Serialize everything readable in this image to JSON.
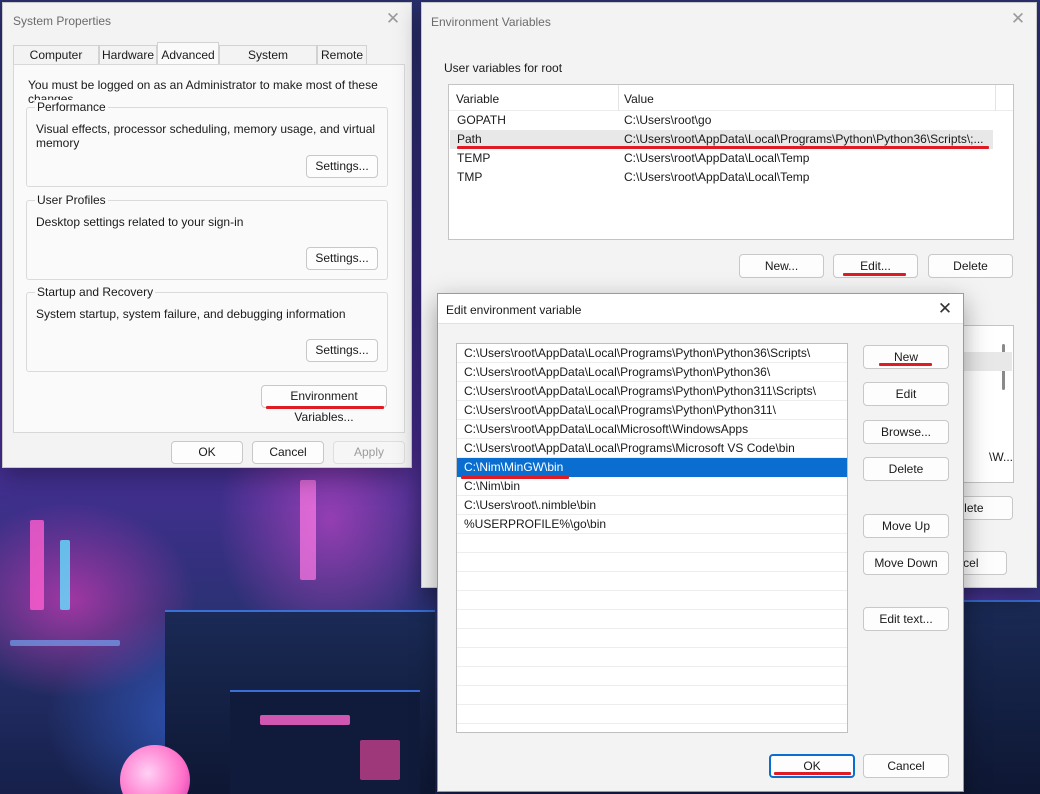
{
  "system_properties": {
    "title": "System Properties",
    "tabs": [
      "Computer Name",
      "Hardware",
      "Advanced",
      "System Protection",
      "Remote"
    ],
    "active_tab": "Advanced",
    "notice": "You must be logged on as an Administrator to make most of these changes.",
    "groups": [
      {
        "title": "Performance",
        "desc": "Visual effects, processor scheduling, memory usage, and virtual memory",
        "button": "Settings..."
      },
      {
        "title": "User Profiles",
        "desc": "Desktop settings related to your sign-in",
        "button": "Settings..."
      },
      {
        "title": "Startup and Recovery",
        "desc": "System startup, system failure, and debugging information",
        "button": "Settings..."
      }
    ],
    "env_button": "Environment Variables...",
    "ok": "OK",
    "cancel": "Cancel",
    "apply": "Apply"
  },
  "environment_variables": {
    "title": "Environment Variables",
    "user_section": "User variables for root",
    "columns": [
      "Variable",
      "Value"
    ],
    "rows": [
      {
        "variable": "GOPATH",
        "value": "C:\\Users\\root\\go"
      },
      {
        "variable": "Path",
        "value": "C:\\Users\\root\\AppData\\Local\\Programs\\Python\\Python36\\Scripts\\;..."
      },
      {
        "variable": "TEMP",
        "value": "C:\\Users\\root\\AppData\\Local\\Temp"
      },
      {
        "variable": "TMP",
        "value": "C:\\Users\\root\\AppData\\Local\\Temp"
      }
    ],
    "new": "New...",
    "edit": "Edit...",
    "delete": "Delete",
    "partial_value": "\\W...",
    "partial_delete": "elete",
    "partial_cancel": "ncel"
  },
  "edit_env_var": {
    "title": "Edit environment variable",
    "entries": [
      "C:\\Users\\root\\AppData\\Local\\Programs\\Python\\Python36\\Scripts\\",
      "C:\\Users\\root\\AppData\\Local\\Programs\\Python\\Python36\\",
      "C:\\Users\\root\\AppData\\Local\\Programs\\Python\\Python311\\Scripts\\",
      "C:\\Users\\root\\AppData\\Local\\Programs\\Python\\Python311\\",
      "C:\\Users\\root\\AppData\\Local\\Microsoft\\WindowsApps",
      "C:\\Users\\root\\AppData\\Local\\Programs\\Microsoft VS Code\\bin",
      "C:\\Nim\\MinGW\\bin",
      "C:\\Nim\\bin",
      "C:\\Users\\root\\.nimble\\bin",
      "%USERPROFILE%\\go\\bin"
    ],
    "selected_index": 6,
    "buttons": {
      "new": "New",
      "edit": "Edit",
      "browse": "Browse...",
      "delete": "Delete",
      "move_up": "Move Up",
      "move_down": "Move Down",
      "edit_text": "Edit text..."
    },
    "ok": "OK",
    "cancel": "Cancel"
  },
  "colors": {
    "accent": "#0a6ed1",
    "highlight": "#e01b24"
  }
}
